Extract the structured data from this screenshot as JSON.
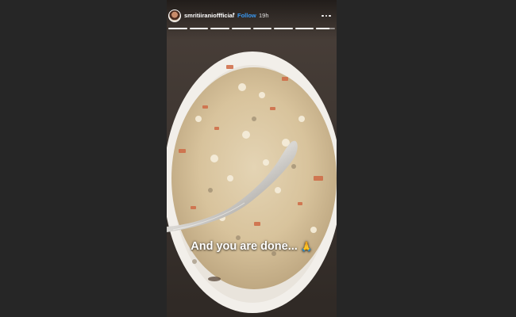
{
  "story": {
    "username": "smritiiranioffficial",
    "separator": "•",
    "follow_label": "Follow",
    "time_ago": "19h",
    "more_icon": "more-horizontal-icon",
    "progress": {
      "segments": 8,
      "completed": 8,
      "current_fraction": 0.7
    },
    "caption": "And you are done...",
    "caption_emoji": "folded-hands-icon"
  },
  "colors": {
    "page_background": "#262626",
    "follow_link": "#3897f0",
    "text": "#ffffff"
  }
}
